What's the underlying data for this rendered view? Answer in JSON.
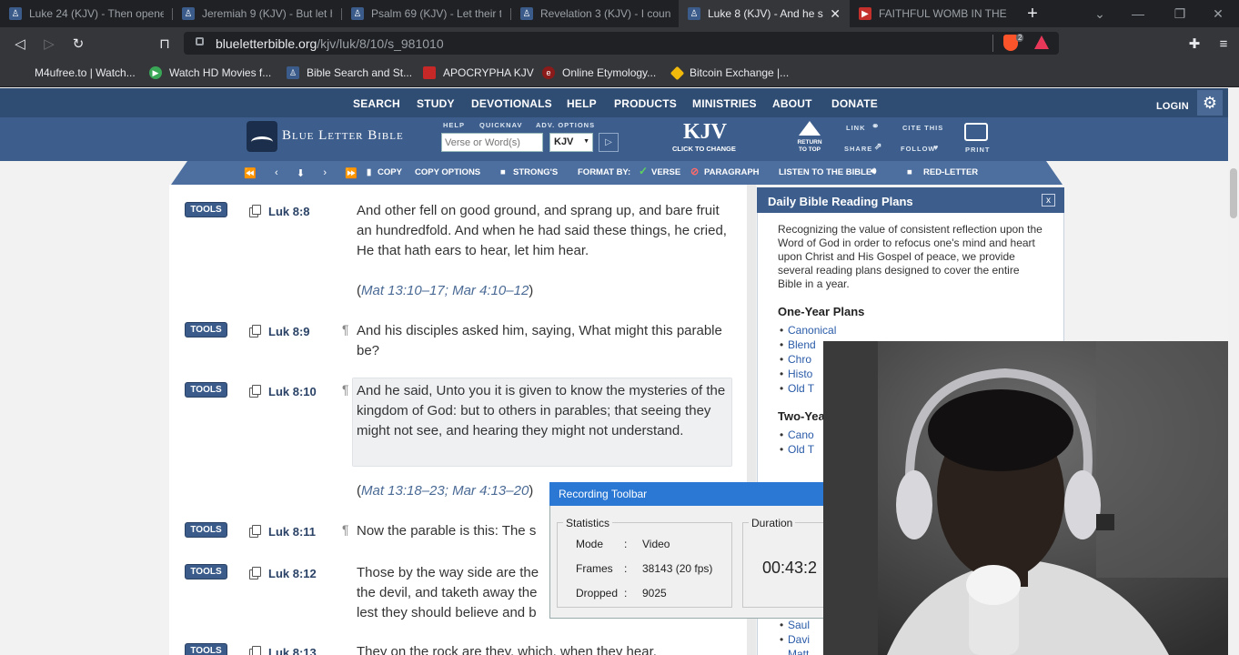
{
  "browser": {
    "tabs": [
      {
        "title": "Luke 24 (KJV) - Then opene",
        "active": false
      },
      {
        "title": "Jeremiah 9 (KJV) - But let h",
        "active": false
      },
      {
        "title": "Psalm 69 (KJV) - Let their ta",
        "active": false
      },
      {
        "title": "Revelation 3 (KJV) - I couns",
        "active": false
      },
      {
        "title": "Luke 8 (KJV) - And he s",
        "active": true
      },
      {
        "title": "FAITHFUL WOMB IN THE B",
        "active": false
      }
    ],
    "url_host": "blueletterbible.org",
    "url_path": "/kjv/luk/8/10/s_981010",
    "shield_count": "2",
    "bookmarks": [
      "M4ufree.to | Watch...",
      "Watch HD Movies f...",
      "Bible Search and St...",
      "APOCRYPHA KJV",
      "Online Etymology...",
      "Bitcoin Exchange |..."
    ]
  },
  "site_nav": {
    "items": [
      "SEARCH",
      "STUDY",
      "DEVOTIONALS",
      "HELP",
      "PRODUCTS",
      "MINISTRIES",
      "ABOUT",
      "DONATE"
    ],
    "login": "LOGIN"
  },
  "header": {
    "logo_text": "Blue Letter Bible",
    "small_labels": [
      "HELP",
      "QUICKNAV",
      "ADV. OPTIONS"
    ],
    "search_placeholder": "Verse or Word(s)",
    "version_select": "KJV",
    "version_big": "KJV",
    "version_hint": "CLICK TO CHANGE",
    "return_top": "RETURN TO TOP",
    "link_label": "LINK",
    "share_label": "SHARE",
    "cite_label": "CITE THIS",
    "follow_label": "FOLLOW",
    "print_label": "PRINT"
  },
  "subbar": {
    "copy": "COPY",
    "copy_options": "COPY OPTIONS",
    "strongs": "STRONG'S",
    "format_by": "FORMAT BY:",
    "verse": "VERSE",
    "paragraph": "PARAGRAPH",
    "listen": "LISTEN TO THE BIBLE",
    "red_letter": "RED-LETTER"
  },
  "verses": [
    {
      "tools": "TOOLS",
      "ref": "Luk 8:8",
      "para": false,
      "text": "And other fell on good ground, and sprang up, and bare fruit an hundredfold. And when he had said these things, he cried, He that hath ears to hear, let him hear.",
      "xref": "Mat 13:10–17; Mar 4:10–12"
    },
    {
      "tools": "TOOLS",
      "ref": "Luk 8:9",
      "para": true,
      "text": "And his disciples asked him, saying, What might this parable be?",
      "xref": ""
    },
    {
      "tools": "TOOLS",
      "ref": "Luk 8:10",
      "para": true,
      "text": "And he said, Unto you it is given to know the mysteries of the kingdom of God: but to others in parables; that seeing they might not see, and hearing they might not understand.",
      "xref": "Mat 13:18–23; Mar 4:13–20"
    },
    {
      "tools": "TOOLS",
      "ref": "Luk 8:11",
      "para": true,
      "text": "Now the parable is this: The s",
      "xref": ""
    },
    {
      "tools": "TOOLS",
      "ref": "Luk 8:12",
      "para": false,
      "text": "Those by the way side are the the devil, and taketh away the lest they should believe and b",
      "xref": ""
    },
    {
      "tools": "TOOLS",
      "ref": "Luk 8:13",
      "para": false,
      "text": "They on the rock are they, which, when they hear,",
      "xref": ""
    }
  ],
  "panel": {
    "title": "Daily Bible Reading Plans",
    "close": "x",
    "description": "Recognizing the value of consistent reflection upon the Word of God in order to refocus one's mind and heart upon Christ and His Gospel of peace, we provide several reading plans designed to cover the entire Bible in a year.",
    "one_year_heading": "One-Year Plans",
    "one_year": [
      "Canonical",
      "Blend",
      "Chro",
      "Histo",
      "Old T"
    ],
    "two_year_heading": "Two-Yea",
    "two_year": [
      "Cano",
      "Old T"
    ],
    "lower": [
      "Saul",
      "Davi",
      "Matt"
    ]
  },
  "recording": {
    "title": "Recording Toolbar",
    "stats_label": "Statistics",
    "duration_label": "Duration",
    "mode_label": "Mode",
    "mode_value": "Video",
    "frames_label": "Frames",
    "frames_value": "38143 (20 fps)",
    "dropped_label": "Dropped",
    "dropped_value": "9025",
    "duration_value": "00:43:2"
  }
}
